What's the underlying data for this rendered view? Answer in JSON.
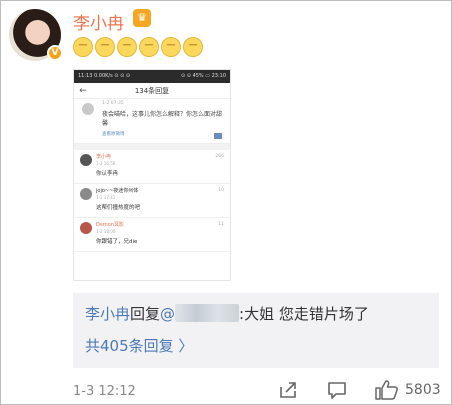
{
  "user": {
    "name": "李小冉"
  },
  "emojis": [
    "😑",
    "😑",
    "😑",
    "😑",
    "😑",
    "😑"
  ],
  "shot": {
    "status_left": "11:13 0.00K/s ⊙ ⊙ ⊙",
    "status_right": "⊙ ⊙ 45% ▭ 23:10",
    "title": "134条回复",
    "post_time": "1-2 07:35",
    "post_body": "夜会喵哈，这事儿你怎么解释？你怎么面对甜馨",
    "post_link": "查看原微博",
    "comments": [
      {
        "name": "李小冉",
        "time": "1-2 16:56",
        "text": "你认李冉",
        "likes": "266"
      },
      {
        "name": "jojo~~夜迷你州体",
        "time": "1-2 17:41",
        "text": "这帮们撞热度的吧",
        "likes": "10"
      },
      {
        "name": "Demon冥影",
        "time": "1-2 18:00",
        "text": "你跟错了，兄die",
        "likes": "11"
      }
    ]
  },
  "reply": {
    "name": "李小冉",
    "verb": "回复",
    "mention": "@",
    "text": ":大姐 您走错片场了",
    "more": "共405条回复 〉"
  },
  "footer": {
    "time": "1-3 12:12",
    "likes": "5803"
  }
}
